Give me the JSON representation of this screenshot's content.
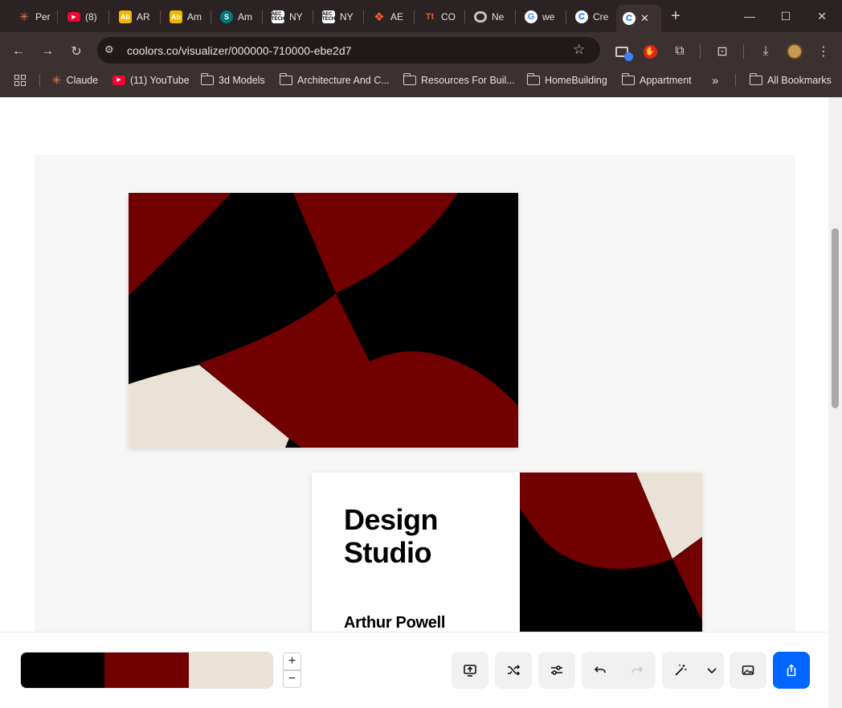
{
  "browser": {
    "tabs": [
      {
        "title": "Per",
        "icon": "claude-icon"
      },
      {
        "title": "(8)",
        "icon": "youtube-icon"
      },
      {
        "title": "AR",
        "icon": "ab-icon"
      },
      {
        "title": "Am",
        "icon": "ab-icon"
      },
      {
        "title": "Am",
        "icon": "sharepoint-icon"
      },
      {
        "title": "NY",
        "icon": "aec-tech-icon"
      },
      {
        "title": "NY",
        "icon": "aec-tech-icon"
      },
      {
        "title": "AE",
        "icon": "aec-icon"
      },
      {
        "title": "CO",
        "icon": "tt-icon"
      },
      {
        "title": "Ne",
        "icon": "chrome-icon"
      },
      {
        "title": "we",
        "icon": "google-icon"
      },
      {
        "title": "Cre",
        "icon": "coolors-icon"
      },
      {
        "title": "",
        "icon": "coolors-icon",
        "active": true
      }
    ],
    "url": "coolors.co/visualizer/000000-710000-ebe2d7",
    "bookmarks": [
      {
        "label": "Claude",
        "icon": "claude-icon"
      },
      {
        "label": "(11) YouTube",
        "icon": "youtube-icon"
      },
      {
        "label": "3d Models",
        "icon": "folder-icon"
      },
      {
        "label": "Architecture And C...",
        "icon": "folder-icon"
      },
      {
        "label": "Resources For Buil...",
        "icon": "folder-icon"
      },
      {
        "label": "HomeBuilding",
        "icon": "folder-icon"
      },
      {
        "label": "Appartment",
        "icon": "folder-icon"
      },
      {
        "label": "»",
        "icon": ""
      },
      {
        "label": "All Bookmarks",
        "icon": "folder-icon"
      }
    ],
    "window_controls": {
      "minimize": "—",
      "maximize": "☐",
      "close": "✕"
    }
  },
  "visualizer": {
    "card_front": {
      "studio_line1": "Design",
      "studio_line2": "Studio",
      "person_name": "Arthur Powell"
    },
    "palette": {
      "colors": [
        "#000000",
        "#710000",
        "#ebe2d7"
      ]
    },
    "zoom": {
      "plus": "+",
      "minus": "−"
    },
    "tools": [
      {
        "name": "present",
        "icon": "present-icon"
      },
      {
        "name": "shuffle",
        "icon": "shuffle-icon"
      },
      {
        "name": "adjust",
        "icon": "sliders-icon"
      },
      {
        "name": "undo",
        "icon": "undo-icon"
      },
      {
        "name": "redo",
        "icon": "redo-icon"
      },
      {
        "name": "magic",
        "icon": "magic-wand-icon"
      },
      {
        "name": "more",
        "icon": "chevron-down-icon"
      },
      {
        "name": "image",
        "icon": "image-icon"
      },
      {
        "name": "export",
        "icon": "share-icon"
      }
    ]
  }
}
